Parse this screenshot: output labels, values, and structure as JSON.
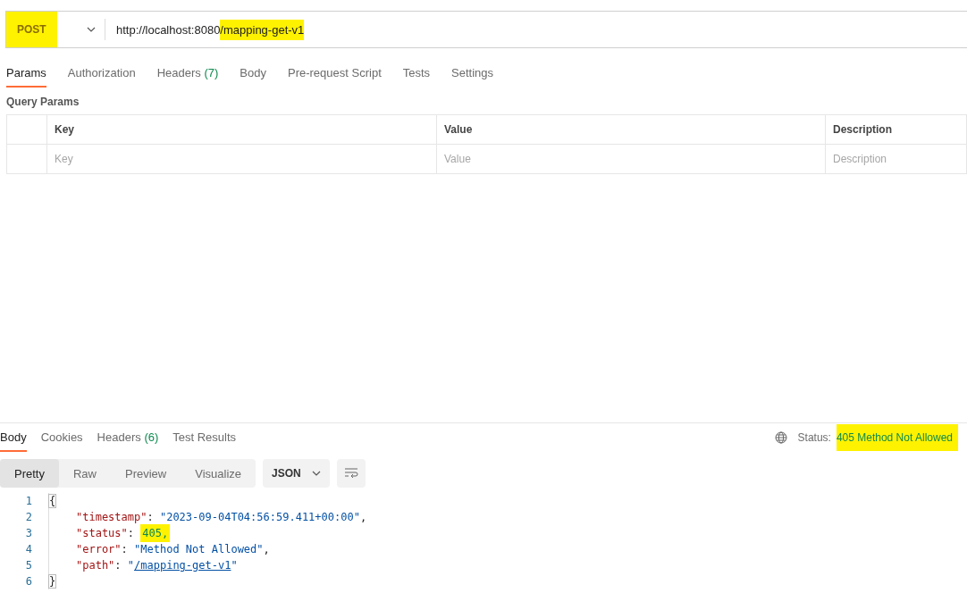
{
  "request": {
    "method": {
      "label": "POST",
      "highlighted": true
    },
    "url_parts": [
      {
        "text": "http://localhost:8080",
        "highlighted": false
      },
      {
        "text": "/mapping-get-v1",
        "highlighted": true
      }
    ]
  },
  "request_tabs": [
    {
      "label": "Params",
      "selected": true
    },
    {
      "label": "Authorization",
      "selected": false
    },
    {
      "label": "Headers",
      "count": "(7)",
      "selected": false
    },
    {
      "label": "Body",
      "selected": false
    },
    {
      "label": "Pre-request Script",
      "selected": false
    },
    {
      "label": "Tests",
      "selected": false
    },
    {
      "label": "Settings",
      "selected": false
    }
  ],
  "query_params": {
    "title": "Query Params",
    "columns": [
      "Key",
      "Value",
      "Description"
    ],
    "placeholders": [
      "Key",
      "Value",
      "Description"
    ]
  },
  "response_tabs": [
    {
      "label": "Body",
      "selected": true
    },
    {
      "label": "Cookies",
      "selected": false
    },
    {
      "label": "Headers",
      "count": "(6)",
      "selected": false
    },
    {
      "label": "Test Results",
      "selected": false
    }
  ],
  "status": {
    "label": "Status:",
    "value": "405 Method Not Allowed",
    "highlighted": true
  },
  "view_modes": [
    {
      "label": "Pretty",
      "selected": true
    },
    {
      "label": "Raw",
      "selected": false
    },
    {
      "label": "Preview",
      "selected": false
    },
    {
      "label": "Visualize",
      "selected": false
    }
  ],
  "format": "JSON",
  "code_lines": [
    {
      "number": "1",
      "tokens": [
        {
          "text": "{",
          "kind": "brace"
        }
      ]
    },
    {
      "number": "2",
      "tokens": [
        {
          "text": "\"timestamp\"",
          "kind": "key"
        },
        {
          "text": ": ",
          "kind": "punct"
        },
        {
          "text": "\"2023-09-04T04:56:59.411+00:00\"",
          "kind": "string"
        },
        {
          "text": ",",
          "kind": "punct"
        }
      ]
    },
    {
      "number": "3",
      "tokens": [
        {
          "text": "\"status\"",
          "kind": "key"
        },
        {
          "text": ": ",
          "kind": "punct"
        },
        {
          "text": "405,",
          "kind": "number_marked"
        }
      ]
    },
    {
      "number": "4",
      "tokens": [
        {
          "text": "\"error\"",
          "kind": "key"
        },
        {
          "text": ": ",
          "kind": "punct"
        },
        {
          "text": "\"Method Not Allowed\"",
          "kind": "string"
        },
        {
          "text": ",",
          "kind": "punct"
        }
      ]
    },
    {
      "number": "5",
      "tokens": [
        {
          "text": "\"path\"",
          "kind": "key"
        },
        {
          "text": ": ",
          "kind": "punct"
        },
        {
          "text": "\"",
          "kind": "string"
        },
        {
          "text": "/mapping-get-v1",
          "kind": "link"
        },
        {
          "text": "\"",
          "kind": "string"
        }
      ]
    },
    {
      "number": "6",
      "tokens": [
        {
          "text": "}",
          "kind": "brace"
        }
      ]
    }
  ]
}
